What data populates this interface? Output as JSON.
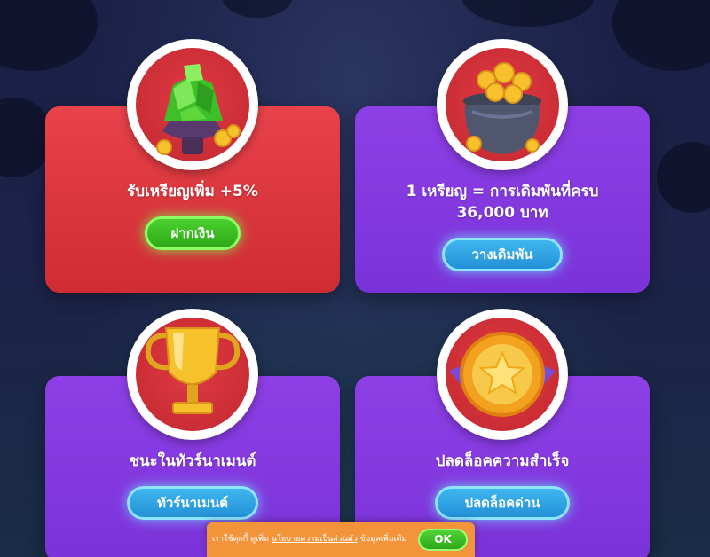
{
  "cards": [
    {
      "title": "รับเหรียญเพิ่ม +5%",
      "button": "ฝากเงิน",
      "theme": "red",
      "icon": "green-gems-bowl-icon"
    },
    {
      "title_line1": "1 เหรียญ = การเดิมพันที่ครบ",
      "title_line2": "36,000 บาท",
      "button": "วางเดิมพัน",
      "theme": "purple",
      "icon": "coin-pot-icon"
    },
    {
      "title": "ชนะในทัวร์นาเมนต์",
      "button": "ทัวร์นาเมนต์",
      "theme": "purple",
      "icon": "gold-trophy-icon"
    },
    {
      "title": "ปลดล็อคความสำเร็จ",
      "button": "ปลดล็อคด่าน",
      "theme": "purple",
      "icon": "star-badge-icon"
    }
  ],
  "cookie_banner": {
    "text_before": "เราใช้คุกกี้ ดูเพิ่ม",
    "link": "นโยบายความเป็นส่วนตัว",
    "text_after": "ข้อมูลเพิ่มเติม",
    "ok": "OK"
  },
  "colors": {
    "card_red": "#e8424a",
    "card_purple": "#8e3fe6",
    "button_green": "#3fc125",
    "button_blue": "#2fa3e6",
    "cookie_orange": "#f4943a"
  }
}
